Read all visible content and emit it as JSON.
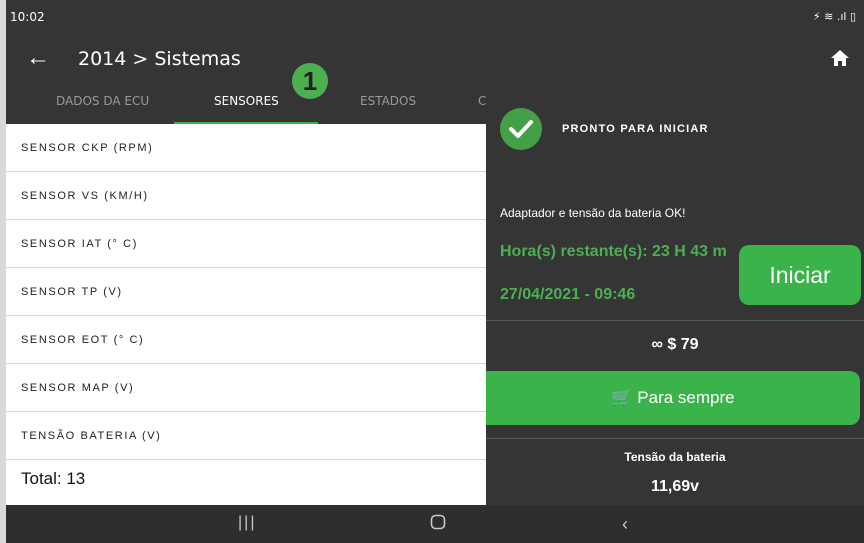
{
  "status": {
    "time": "10:02",
    "icons": "⚡ ≋ .ıl ▯"
  },
  "appbar": {
    "title": "2014 > Sistemas"
  },
  "tabs": [
    "DADOS DA ECU",
    "SENSORES",
    "ESTADOS",
    "C"
  ],
  "badge": "1",
  "sensors": [
    "SENSOR CKP (RPM)",
    "SENSOR VS (KM/H)",
    "SENSOR IAT (° C)",
    "SENSOR TP (V)",
    "SENSOR EOT (° C)",
    "SENSOR MAP (V)",
    "TENSÃO BATERIA (V)"
  ],
  "total": "Total: 13",
  "panel": {
    "ready": "PRONTO PARA INICIAR",
    "adapter": "Adaptador e tensão da bateria OK!",
    "time_remaining": "Hora(s) restante(s): 23 H 43 m",
    "date": "27/04/2021 - 09:46",
    "start": "Iniciar",
    "price": "$ 79",
    "buy": "Para sempre",
    "battery_label": "Tensão da bateria",
    "battery_value": "11,69v"
  },
  "colors": {
    "accent": "#3ab34a",
    "background": "#353535",
    "list": "#ffffff"
  }
}
